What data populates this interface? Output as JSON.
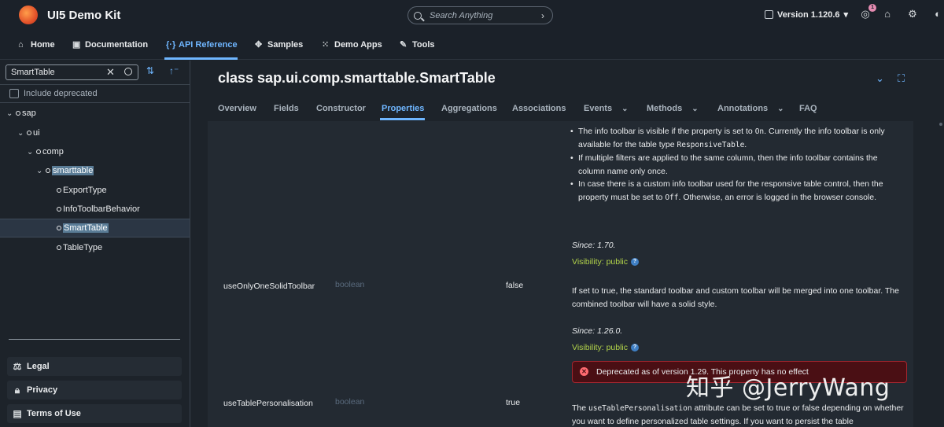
{
  "header": {
    "app_title": "UI5 Demo Kit",
    "search_placeholder": "Search Anything",
    "version": "Version 1.120.6",
    "notification_count": "1"
  },
  "nav": {
    "items": [
      {
        "label": "Home",
        "icon": "home-icon"
      },
      {
        "label": "Documentation",
        "icon": "book-icon"
      },
      {
        "label": "API Reference",
        "icon": "code-icon",
        "active": true
      },
      {
        "label": "Samples",
        "icon": "samples-icon"
      },
      {
        "label": "Demo Apps",
        "icon": "grid-icon"
      },
      {
        "label": "Tools",
        "icon": "wrench-icon"
      }
    ]
  },
  "sidebar": {
    "filter_value": "SmartTable",
    "include_deprecated": "Include deprecated",
    "tree": [
      {
        "label": "sap",
        "level": 0
      },
      {
        "label": "ui",
        "level": 1
      },
      {
        "label": "comp",
        "level": 2
      },
      {
        "label": "smarttable",
        "level": 3
      },
      {
        "label": "ExportType",
        "level": 4
      },
      {
        "label": "InfoToolbarBehavior",
        "level": 4
      },
      {
        "label": "SmartTable",
        "level": 4,
        "selected": true
      },
      {
        "label": "TableType",
        "level": 4
      }
    ],
    "footer": [
      {
        "label": "Legal",
        "icon": "scale-icon"
      },
      {
        "label": "Privacy",
        "icon": "lock-icon"
      },
      {
        "label": "Terms of Use",
        "icon": "document-icon"
      }
    ]
  },
  "page": {
    "title": "class sap.ui.comp.smarttable.SmartTable",
    "tabs": [
      {
        "label": "Overview"
      },
      {
        "label": "Fields"
      },
      {
        "label": "Constructor"
      },
      {
        "label": "Properties",
        "active": true
      },
      {
        "label": "Aggregations"
      },
      {
        "label": "Associations"
      },
      {
        "label": "Events",
        "dropdown": true
      },
      {
        "label": "Methods",
        "dropdown": true
      },
      {
        "label": "Annotations",
        "dropdown": true
      },
      {
        "label": "FAQ"
      }
    ]
  },
  "content": {
    "bullets": {
      "b1_pre": "The info toolbar is visible if the property is set to ",
      "b1_code": "On",
      "b1_post": ". Currently the info toolbar is only available for the table type ",
      "b1_code2": "ResponsiveTable",
      "b1_end": ".",
      "b2": "If multiple filters are applied to the same column, then the info toolbar contains the column name only once.",
      "b3_pre": "In case there is a custom info toolbar used for the responsive table control, then the property must be set to ",
      "b3_code": "Off",
      "b3_post": ". Otherwise, an error is logged in the browser console."
    },
    "since1": "Since: 1.70.",
    "visibility1": "Visibility: public",
    "row1": {
      "name": "useOnlyOneSolidToolbar",
      "type": "boolean",
      "default": "false",
      "desc": "If set to true, the standard toolbar and custom toolbar will be merged into one toolbar. The combined toolbar will have a solid style."
    },
    "since2": "Since: 1.26.0.",
    "visibility2": "Visibility: public",
    "deprecated": "Deprecated as of version 1.29. This property has no effect",
    "row2": {
      "name": "useTablePersonalisation",
      "type": "boolean",
      "default": "true",
      "desc_pre": "The ",
      "desc_code": "useTablePersonalisation",
      "desc_post": " attribute can be set to true or false depending on whether you want to define personalized table settings. If you want to persist the table"
    }
  },
  "watermark": "知乎 @JerryWang"
}
